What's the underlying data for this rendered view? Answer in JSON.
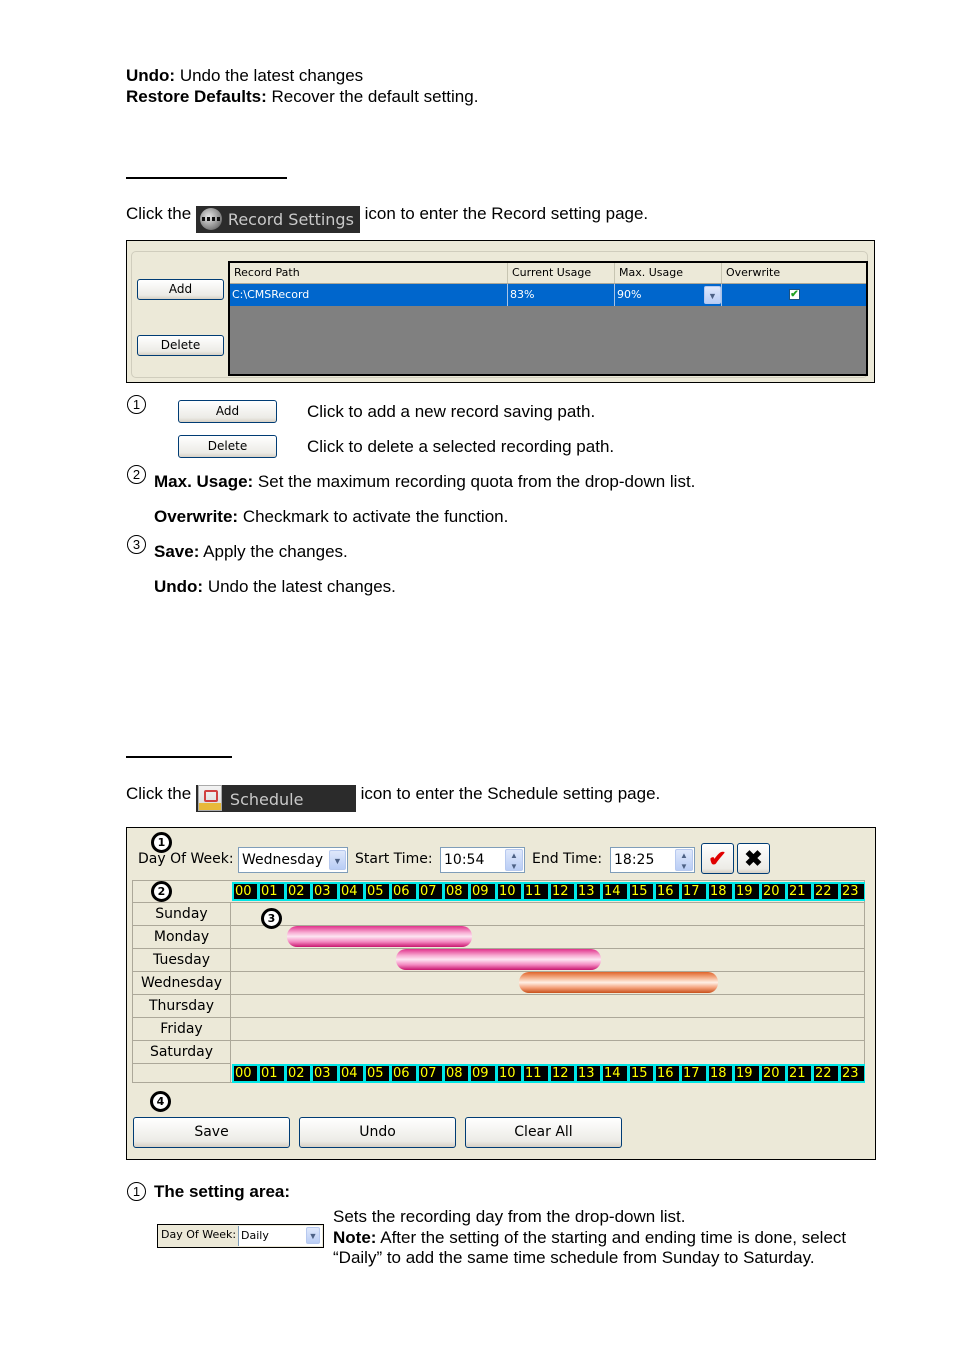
{
  "intro": {
    "undo": {
      "term": "Undo:",
      "desc": " Undo the latest changes"
    },
    "restore": {
      "term": "Restore Defaults:",
      "desc": " Recover the default setting."
    }
  },
  "record_section": {
    "click_prefix": "Click the ",
    "icon_label": "Record Settings",
    "icon_name": "record-settings-icon",
    "click_suffix": " icon to enter the Record setting page.",
    "panel": {
      "add_button": "Add",
      "delete_button": "Delete",
      "columns": [
        "Record Path",
        "Current Usage",
        "Max. Usage",
        "Overwrite"
      ],
      "rows": [
        {
          "record_path": "C:\\CMSRecord",
          "current_usage": "83%",
          "max_usage": "90%",
          "overwrite": true
        }
      ]
    },
    "notes": [
      {
        "marker": "1",
        "button": "Add",
        "desc": "Click to add a new record saving path."
      },
      {
        "marker": "",
        "button": "Delete",
        "desc": "Click to delete a selected recording path."
      },
      {
        "marker": "2",
        "term": "Max. Usage:",
        "desc": " Set the maximum recording quota from the drop-down list."
      },
      {
        "marker": "",
        "term": "Overwrite:",
        "desc": " Checkmark to activate the function."
      },
      {
        "marker": "3",
        "term": "Save:",
        "desc": " Apply the changes."
      },
      {
        "marker": "",
        "term": "Undo:",
        "desc": " Undo the latest changes."
      }
    ]
  },
  "schedule_section": {
    "click_prefix": "Click the ",
    "icon_label": "Schedule",
    "icon_name": "schedule-icon",
    "click_suffix": " icon to enter the Schedule setting page.",
    "panel": {
      "markers": [
        "1",
        "2",
        "3",
        "4"
      ],
      "day_of_week_label": "Day Of Week:",
      "day_of_week_value": "Wednesday",
      "start_time_label": "Start Time:",
      "start_time_value": "10:54",
      "end_time_label": "End Time:",
      "end_time_value": "18:25",
      "confirm_icon": "checkmark-icon",
      "cancel_icon": "x-icon",
      "hours": [
        "00",
        "01",
        "02",
        "03",
        "04",
        "05",
        "06",
        "07",
        "08",
        "09",
        "10",
        "11",
        "12",
        "13",
        "14",
        "15",
        "16",
        "17",
        "18",
        "19",
        "20",
        "21",
        "22",
        "23"
      ],
      "days": [
        "Sunday",
        "Monday",
        "Tuesday",
        "Wednesday",
        "Thursday",
        "Friday",
        "Saturday"
      ],
      "schedules": [
        {
          "day": "Monday",
          "start_hour": 2.1,
          "end_hour": 9.1,
          "color": "pink"
        },
        {
          "day": "Tuesday",
          "start_hour": 6.2,
          "end_hour": 14.0,
          "color": "pink"
        },
        {
          "day": "Wednesday",
          "start_hour": 10.9,
          "end_hour": 18.42,
          "color": "orange"
        }
      ],
      "save_button": "Save",
      "undo_button": "Undo",
      "clear_all_button": "Clear All"
    },
    "setting_area": {
      "marker": "1",
      "title": "The setting area:",
      "mini_label": "Day Of Week:",
      "mini_value": "Daily",
      "line1": "Sets the recording day from the drop-down list.",
      "note_term": "Note:",
      "note_text": " After the setting of the starting and ending time is done, select",
      "note_text2": "“Daily” to add the same time schedule from Sunday to Saturday."
    }
  },
  "colors": {
    "selection_blue": "#0066cc",
    "grid_gray": "#808080",
    "panel_beige": "#ece9d8",
    "hour_cell_bg": "#000000",
    "hour_cell_text": "#ffff00",
    "hour_border": "#00e5e5",
    "schedule_pink": "#f06bb0",
    "schedule_orange": "#f28a5a",
    "confirm_red": "#e00000"
  }
}
